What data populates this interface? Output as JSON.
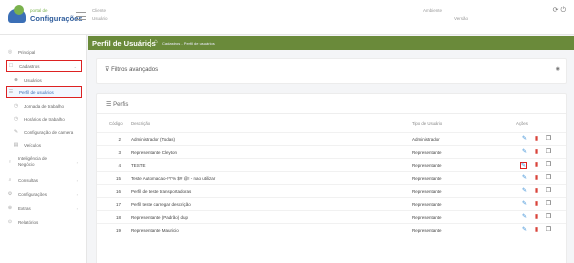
{
  "topbar": {
    "logo_small": "portal de",
    "logo_big": "Configurações",
    "cliente_label": "Cliente",
    "usuario_label": "Usuário",
    "ambiente_label": "Ambiente",
    "versao_label": "Versão"
  },
  "sidebar": {
    "items": [
      {
        "label": "Principal",
        "icon": "grid-icon"
      },
      {
        "label": "Cadastros",
        "icon": "doc-icon"
      },
      {
        "label": "Usuários",
        "icon": "users-icon"
      },
      {
        "label": "Perfil de usuários",
        "icon": "list-icon"
      },
      {
        "label": "Jornada de trabalho",
        "icon": "clock-icon"
      },
      {
        "label": "Horários de trabalho",
        "icon": "clock-icon"
      },
      {
        "label": "Configuração de camera",
        "icon": "pencil-icon"
      },
      {
        "label": "Veículos",
        "icon": "truck-icon"
      },
      {
        "label": "Inteligência de Negócio",
        "icon": "bulb-icon"
      },
      {
        "label": "Consultas",
        "icon": "search-icon"
      },
      {
        "label": "Configurações",
        "icon": "gear-icon"
      },
      {
        "label": "Extras",
        "icon": "plus-icon"
      },
      {
        "label": "Relatórios",
        "icon": "report-icon"
      }
    ]
  },
  "header": {
    "title": "Perfil de Usuários",
    "breadcrumb": "Cadastros - Perfil de usuários"
  },
  "filters": {
    "title": "Filtros avançados"
  },
  "perfis": {
    "title": "Perfis",
    "columns": {
      "code": "Código",
      "desc": "Descrição",
      "type": "Tipo de Usuário",
      "actions": "Ações"
    },
    "rows": [
      {
        "code": "2",
        "desc": "Administrador (Todas)",
        "type": "Administrador"
      },
      {
        "code": "3",
        "desc": "Representante Cleyton",
        "type": "Representante"
      },
      {
        "code": "4",
        "desc": "TESTE",
        "type": "Representante"
      },
      {
        "code": "15",
        "desc": "Teste Automacao-!*!'% $# @! - nao utilizar",
        "type": "Representante"
      },
      {
        "code": "16",
        "desc": "Perfil de teste transportadoras",
        "type": "Representante"
      },
      {
        "code": "17",
        "desc": "Perfil teste carregar descrição",
        "type": "Representante"
      },
      {
        "code": "18",
        "desc": "Representante (Padrão) dup",
        "type": "Representante"
      },
      {
        "code": "19",
        "desc": "Representante Mauricio",
        "type": "Representante"
      }
    ]
  },
  "colors": {
    "header_green": "#6a8a3a",
    "edit_blue": "#3b8fd6",
    "delete_red": "#d9433a",
    "highlight_red": "#dd2222"
  }
}
